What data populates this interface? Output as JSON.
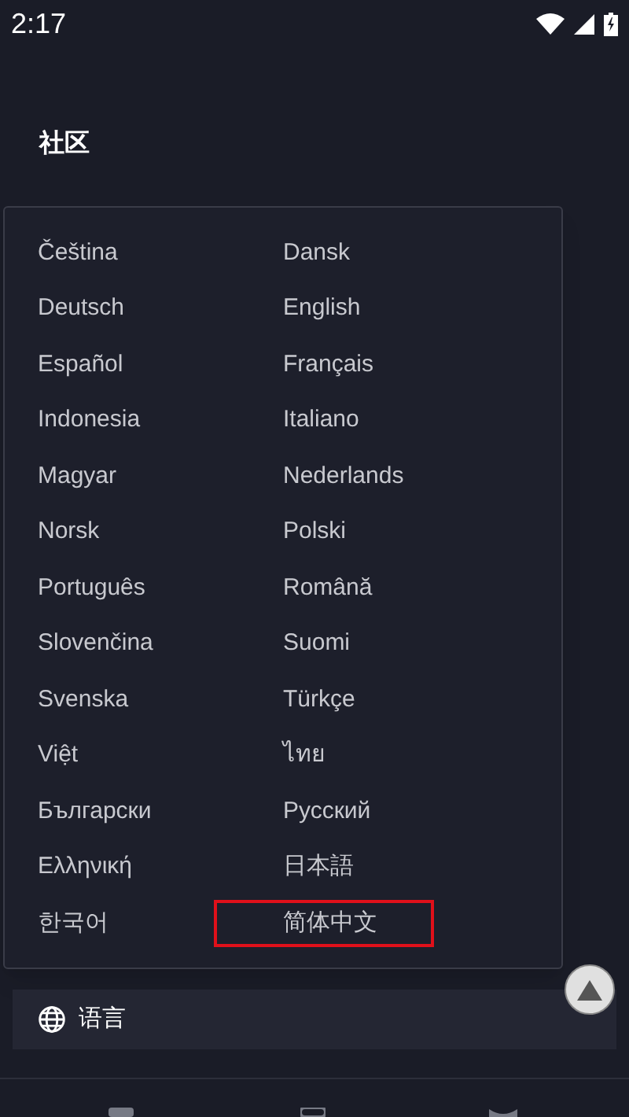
{
  "status_bar": {
    "time": "2:17"
  },
  "section": {
    "title": "社区"
  },
  "language_menu": {
    "options": [
      {
        "label": "Čeština",
        "selected": false
      },
      {
        "label": "Dansk",
        "selected": false
      },
      {
        "label": "Deutsch",
        "selected": false
      },
      {
        "label": "English",
        "selected": false
      },
      {
        "label": "Español",
        "selected": false
      },
      {
        "label": "Français",
        "selected": false
      },
      {
        "label": "Indonesia",
        "selected": false
      },
      {
        "label": "Italiano",
        "selected": false
      },
      {
        "label": "Magyar",
        "selected": false
      },
      {
        "label": "Nederlands",
        "selected": false
      },
      {
        "label": "Norsk",
        "selected": false
      },
      {
        "label": "Polski",
        "selected": false
      },
      {
        "label": "Português",
        "selected": false
      },
      {
        "label": "Română",
        "selected": false
      },
      {
        "label": "Slovenčina",
        "selected": false
      },
      {
        "label": "Suomi",
        "selected": false
      },
      {
        "label": "Svenska",
        "selected": false
      },
      {
        "label": "Türkçe",
        "selected": false
      },
      {
        "label": "Việt",
        "selected": false
      },
      {
        "label": "ไทย",
        "selected": false
      },
      {
        "label": "Български",
        "selected": false
      },
      {
        "label": "Русский",
        "selected": false
      },
      {
        "label": "Ελληνική",
        "selected": false
      },
      {
        "label": "日本語",
        "selected": false
      },
      {
        "label": "한국어",
        "selected": false
      },
      {
        "label": "简体中文",
        "selected": true
      }
    ]
  },
  "language_button": {
    "label": "语言"
  }
}
